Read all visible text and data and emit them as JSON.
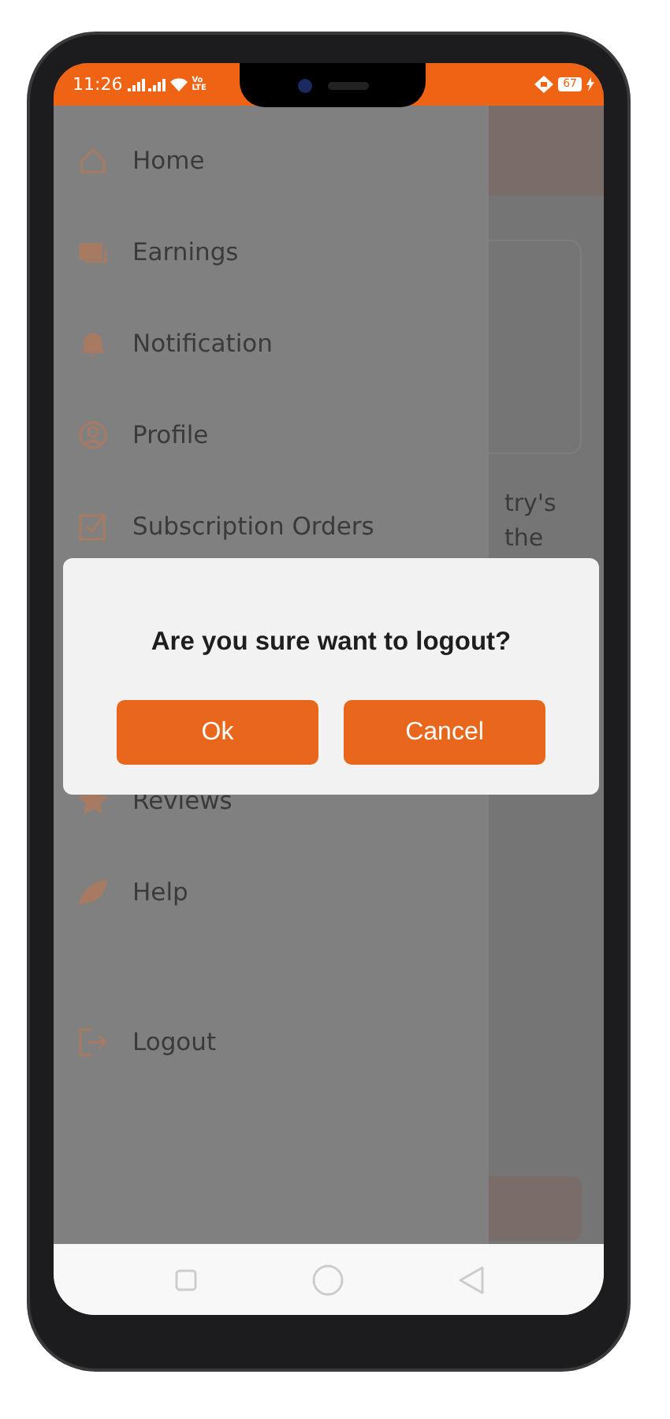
{
  "status_bar": {
    "time": "11:26",
    "network": "Vo LTE",
    "battery": "67"
  },
  "drawer": {
    "items": [
      {
        "label": "Home",
        "kind": "plain"
      },
      {
        "label": "Earnings",
        "kind": "plain"
      },
      {
        "label": "Notification",
        "kind": "plain"
      },
      {
        "label": "Profile",
        "kind": "plain"
      },
      {
        "label": "Subscription Orders",
        "kind": "plain"
      },
      {
        "label": "Reviews",
        "kind": "after_gap"
      },
      {
        "label": "Help",
        "kind": "plain"
      },
      {
        "label": "Logout",
        "kind": "after_gap"
      }
    ]
  },
  "background_texts": [
    "try's",
    "the"
  ],
  "dialog": {
    "message": "Are you sure want to logout?",
    "buttons": [
      "Ok",
      "Cancel"
    ]
  }
}
